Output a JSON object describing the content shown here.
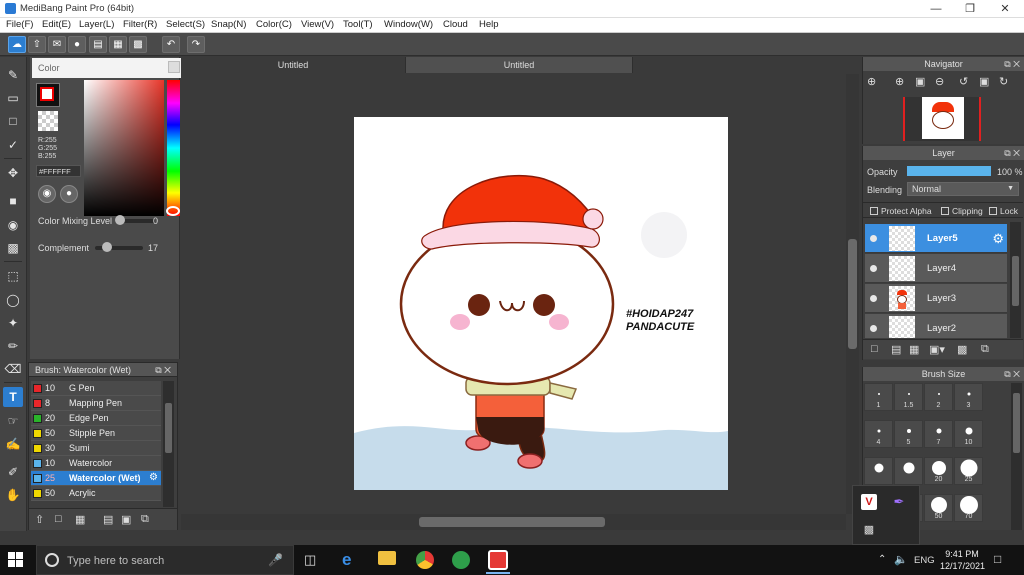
{
  "window": {
    "title": "MediBang Paint Pro (64bit)"
  },
  "menu": [
    "File(F)",
    "Edit(E)",
    "Layer(L)",
    "Filter(R)",
    "Select(S)",
    "Snap(N)",
    "Color(C)",
    "View(V)",
    "Tool(T)",
    "Window(W)",
    "Cloud",
    "Help"
  ],
  "color_panel": {
    "title": "Color",
    "rgb_r": "R:255",
    "rgb_g": "G:255",
    "rgb_b": "B:255",
    "hex": "#FFFFFF",
    "mixing_label": "Color Mixing Level",
    "mixing_value": "0",
    "complement_label": "Complement",
    "complement_value": "17"
  },
  "brush_panel": {
    "title": "Brush: Watercolor (Wet)",
    "items": [
      {
        "size": "10",
        "name": "G Pen",
        "color": "#e8262a"
      },
      {
        "size": "8",
        "name": "Mapping Pen",
        "color": "#e8262a"
      },
      {
        "size": "20",
        "name": "Edge Pen",
        "color": "#2ab42a"
      },
      {
        "size": "50",
        "name": "Stipple Pen",
        "color": "#f0d800"
      },
      {
        "size": "30",
        "name": "Sumi",
        "color": "#f0d800"
      },
      {
        "size": "10",
        "name": "Watercolor",
        "color": "#5ab4ec"
      },
      {
        "size": "25",
        "name": "Watercolor (Wet)",
        "color": "#5ab4ec",
        "selected": true
      },
      {
        "size": "50",
        "name": "Acrylic",
        "color": "#f0d800"
      }
    ]
  },
  "document": {
    "tabs": [
      "Untitled",
      "Untitled"
    ],
    "artwork_text": [
      "#HOIDAP247",
      "PANDACUTE"
    ]
  },
  "navigator": {
    "title": "Navigator"
  },
  "layer_panel": {
    "title": "Layer",
    "opacity_label": "Opacity",
    "opacity_value": "100 %",
    "opacity_fraction": 1.0,
    "blending_label": "Blending",
    "blending_value": "Normal",
    "protect_alpha": "Protect Alpha",
    "clipping": "Clipping",
    "lock": "Lock",
    "layers": [
      {
        "name": "Layer5",
        "selected": true
      },
      {
        "name": "Layer4"
      },
      {
        "name": "Layer3"
      },
      {
        "name": "Layer2"
      }
    ]
  },
  "brush_size_panel": {
    "title": "Brush Size",
    "sizes": [
      "1",
      "1.5",
      "2",
      "3",
      "4",
      "5",
      "7",
      "10",
      "",
      "",
      "20",
      "25",
      "",
      "50",
      "70"
    ]
  },
  "taskbar": {
    "search_placeholder": "Type here to search",
    "language": "ENG",
    "time": "9:41 PM",
    "date": "12/17/2021"
  },
  "colors": {
    "accent": "#2c7ed0",
    "panel": "#3e3e3e",
    "hat": "#f2320a"
  }
}
